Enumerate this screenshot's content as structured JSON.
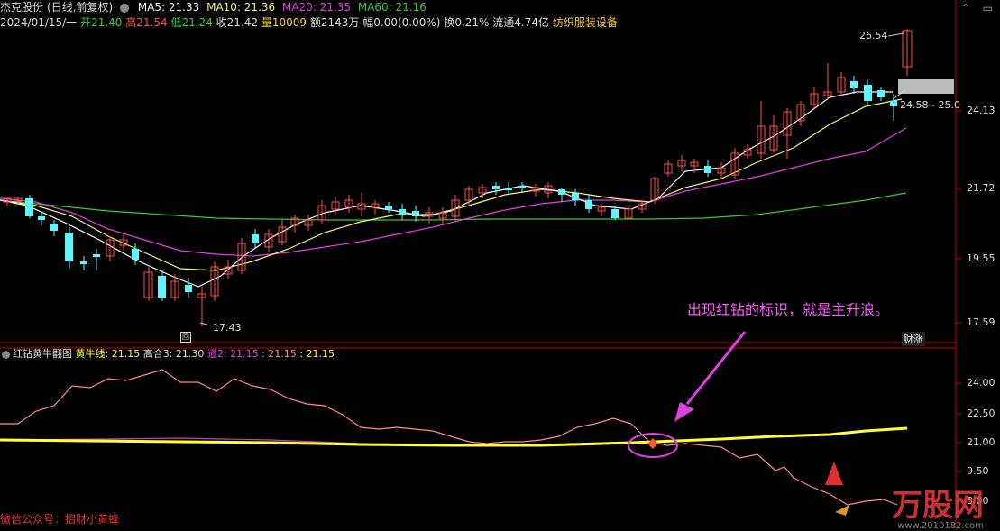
{
  "header": {
    "stock_name": "杰克股份",
    "period": "(日线,前复权)",
    "ma5": "MA5: 21.33",
    "ma10": "MA10: 21.36",
    "ma20": "MA20: 21.35",
    "ma60": "MA60: 21.16",
    "date": "2024/01/15/一",
    "open_label": "开",
    "open": "21.40",
    "high_label": "高",
    "high": "21.54",
    "low_label": "低",
    "low": "21.24",
    "close_label": "收",
    "close": "21.42",
    "volume_label": "量",
    "volume": "10009",
    "amount": "额2143万",
    "change": "幅0.00(0.00%)",
    "turnover": "换0.21%",
    "float": "流通4.74亿",
    "industry": "纺织服装设备"
  },
  "right_axis": {
    "labels": [
      "24.13",
      "21.72",
      "19.55",
      "17.59"
    ],
    "price_marker_high": "26.54",
    "price_marker_range": "24.58 - 25.0",
    "price_low": "17.43",
    "caizhang": "财涨"
  },
  "indicator": {
    "title": "红钻黄牛翻图",
    "huangniu": "黄牛线: 21.15",
    "gaohe": "高合3: 21.30",
    "dao": "道2: 21.15",
    "v4": ": 21.15",
    "v5": ": 21.15",
    "axis": [
      "24.00",
      "22.50",
      "21.00",
      "9.50",
      "8.00"
    ]
  },
  "annotation": "出现红钻的标识，就是主升浪。",
  "footer_text": "微信公众号：招财小黄蜂",
  "watermark": "万股网",
  "watermark_url": "www.2010182.com",
  "colors": {
    "up": "#ff4d4d",
    "down": "#5ff5ff",
    "ma5": "#ffffff",
    "ma10": "#f5f56a",
    "ma20": "#e040e0",
    "ma60": "#33cc33",
    "yellow": "#ffff33"
  }
}
